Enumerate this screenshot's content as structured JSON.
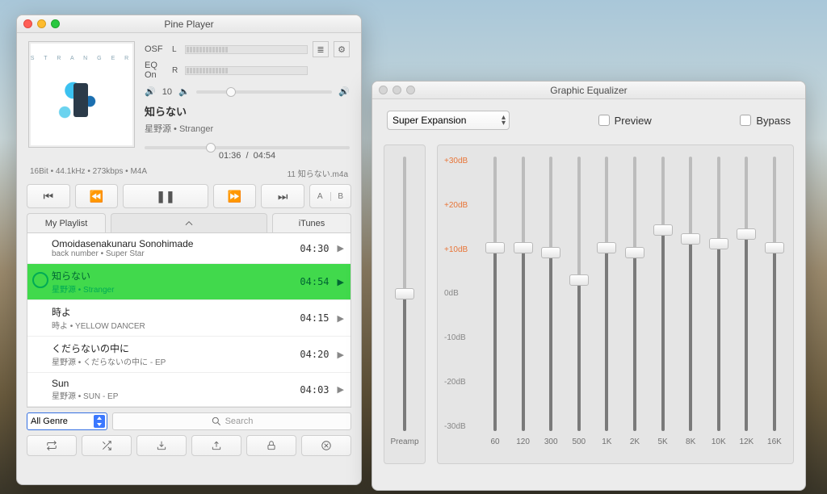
{
  "player": {
    "title": "Pine Player",
    "osf": "OSF",
    "eq_on": "EQ On",
    "channels": [
      "L",
      "R"
    ],
    "output_level": "10",
    "now_playing": {
      "title": "知らない",
      "artist_album": "星野源 • Stranger"
    },
    "progress": {
      "elapsed": "01:36",
      "total": "04:54"
    },
    "stream_info": "16Bit • 44.1kHz • 273kbps • M4A",
    "filename": "11 知らない.m4a",
    "ab_a": "A",
    "ab_b": "B",
    "tabs": {
      "playlist": "My Playlist",
      "itunes": "iTunes"
    },
    "tracks": [
      {
        "title": "Omoidasenakunaru Sonohimade",
        "sub": "back number • Super Star",
        "dur": "04:30"
      },
      {
        "title": "知らない",
        "sub": "星野源 • Stranger",
        "dur": "04:54",
        "selected": true
      },
      {
        "title": "時よ",
        "sub": "時よ • YELLOW DANCER",
        "dur": "04:15"
      },
      {
        "title": "くだらないの中に",
        "sub": "星野源 • くだらないの中に - EP",
        "dur": "04:20"
      },
      {
        "title": "Sun",
        "sub": "星野源 • SUN - EP",
        "dur": "04:03"
      }
    ],
    "genre": "All Genre",
    "search_placeholder": "Search",
    "album_header": "S T R A N G E R"
  },
  "eq": {
    "title": "Graphic Equalizer",
    "preset": "Super Expansion",
    "preview_label": "Preview",
    "bypass_label": "Bypass",
    "preamp_label": "Preamp",
    "scale": [
      "+30dB",
      "+20dB",
      "+10dB",
      "0dB",
      "-10dB",
      "-20dB",
      "-30dB"
    ],
    "bands": [
      {
        "freq": "60",
        "gain_db": 10
      },
      {
        "freq": "120",
        "gain_db": 10
      },
      {
        "freq": "300",
        "gain_db": 9
      },
      {
        "freq": "500",
        "gain_db": 3
      },
      {
        "freq": "1K",
        "gain_db": 10
      },
      {
        "freq": "2K",
        "gain_db": 9
      },
      {
        "freq": "5K",
        "gain_db": 14
      },
      {
        "freq": "8K",
        "gain_db": 12
      },
      {
        "freq": "10K",
        "gain_db": 11
      },
      {
        "freq": "12K",
        "gain_db": 13
      },
      {
        "freq": "16K",
        "gain_db": 10
      }
    ],
    "preamp_db": 0
  },
  "chart_data": {
    "type": "bar",
    "title": "Graphic Equalizer",
    "ylabel": "dB",
    "ylim": [
      -30,
      30
    ],
    "categories": [
      "60",
      "120",
      "300",
      "500",
      "1K",
      "2K",
      "5K",
      "8K",
      "10K",
      "12K",
      "16K"
    ],
    "values": [
      10,
      10,
      9,
      3,
      10,
      9,
      14,
      12,
      11,
      13,
      10
    ]
  }
}
